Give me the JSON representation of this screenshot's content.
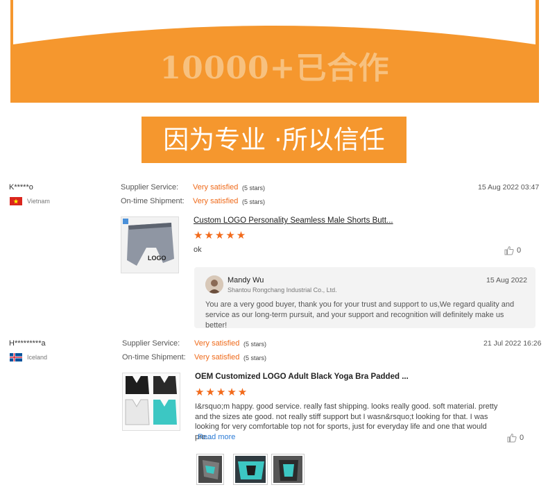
{
  "banner": {
    "headline": "10000+已合作",
    "slogan": "因为专业 ·所以信任"
  },
  "colors": {
    "brand_orange": "#f5972e",
    "accent": "#ef6a1a",
    "link_blue": "#2b7bd6"
  },
  "reviews": [
    {
      "buyer": "K*****o",
      "country": "Vietnam",
      "date": "15 Aug 2022 03:47",
      "supplier_label": "Supplier Service:",
      "supplier_value": "Very satisfied",
      "supplier_stars": "(5 stars)",
      "shipment_label": "On-time Shipment:",
      "shipment_value": "Very satisfied",
      "shipment_stars": "(5 stars)",
      "product_title": "Custom LOGO Personality Seamless Male Shorts Butt...",
      "product_logo": "LOGO",
      "rating": "★★★★★",
      "text": "ok",
      "likes": "0",
      "reply": {
        "name": "Mandy Wu",
        "company": "Shantou Rongchang Industrial Co., Ltd.",
        "date": "15 Aug 2022",
        "text": "You are a very good buyer, thank you for your trust and support to us,We regard quality and service as our long-term pursuit, and your support and recognition will definitely make us better!"
      }
    },
    {
      "buyer": "H*********a",
      "country": "Iceland",
      "date": "21 Jul 2022 16:26",
      "supplier_label": "Supplier Service:",
      "supplier_value": "Very satisfied",
      "supplier_stars": "(5 stars)",
      "shipment_label": "On-time Shipment:",
      "shipment_value": "Very satisfied",
      "shipment_stars": "(5 stars)",
      "product_title": "OEM Customized LOGO Adult Black Yoga Bra Padded ...",
      "rating": "★★★★★",
      "text": "I&rsquo;m happy. good service. really fast shipping. looks really good. soft material. pretty and the sizes ate good. not really stiff support but I wasn&rsquo;t looking for that. I was looking for very comfortable top not for sports, just for everyday life and one that would pre...",
      "read_more": "Read more",
      "likes": "0"
    }
  ]
}
